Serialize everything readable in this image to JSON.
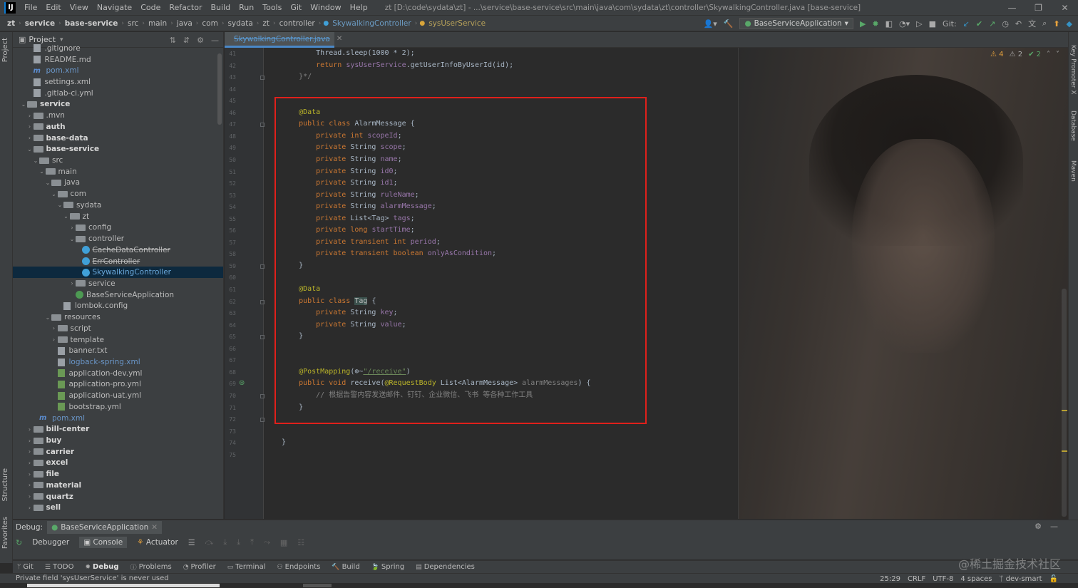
{
  "app": {
    "logo": "IJ",
    "menu": [
      "File",
      "Edit",
      "View",
      "Navigate",
      "Code",
      "Refactor",
      "Build",
      "Run",
      "Tools",
      "Git",
      "Window",
      "Help"
    ],
    "window_title": "zt [D:\\code\\sydata\\zt] - ...\\service\\base-service\\src\\main\\java\\com\\sydata\\zt\\controller\\SkywalkingController.java [base-service]",
    "window_controls": [
      "—",
      "❐",
      "✕"
    ]
  },
  "breadcrumbs": [
    {
      "label": "zt",
      "style": "bold"
    },
    {
      "label": "service",
      "style": "bold"
    },
    {
      "label": "base-service",
      "style": "bold"
    },
    {
      "label": "src",
      "style": ""
    },
    {
      "label": "main",
      "style": ""
    },
    {
      "label": "java",
      "style": ""
    },
    {
      "label": "com",
      "style": ""
    },
    {
      "label": "sydata",
      "style": ""
    },
    {
      "label": "zt",
      "style": ""
    },
    {
      "label": "controller",
      "style": ""
    },
    {
      "label": "SkywalkingController",
      "style": "class"
    },
    {
      "label": "sysUserService",
      "style": "method"
    }
  ],
  "toolbar": {
    "run_config": "BaseServiceApplication",
    "git_label": "Git:"
  },
  "side_tabs": {
    "left_top": "Project",
    "left_mid": "Structure",
    "left_bot": "Favorites",
    "right_1": "Key Promoter X",
    "right_2": "Database",
    "right_3": "Maven"
  },
  "project_panel": {
    "title": "Project",
    "tree": [
      {
        "indent": 1,
        "arrow": "",
        "icon": "file",
        "label": ".gitignore",
        "style": ""
      },
      {
        "indent": 1,
        "arrow": "",
        "icon": "file",
        "label": "README.md",
        "style": ""
      },
      {
        "indent": 1,
        "arrow": "",
        "icon": "maven",
        "label": "pom.xml",
        "style": "blue"
      },
      {
        "indent": 1,
        "arrow": "",
        "icon": "file",
        "label": "settings.xml",
        "style": ""
      },
      {
        "indent": 1,
        "arrow": "",
        "icon": "file",
        "label": ".gitlab-ci.yml",
        "style": ""
      },
      {
        "indent": 0,
        "arrow": "v",
        "icon": "folder",
        "label": "service",
        "style": "bold"
      },
      {
        "indent": 1,
        "arrow": ">",
        "icon": "folder",
        "label": ".mvn",
        "style": ""
      },
      {
        "indent": 1,
        "arrow": ">",
        "icon": "folder",
        "label": "auth",
        "style": "bold"
      },
      {
        "indent": 1,
        "arrow": ">",
        "icon": "folder",
        "label": "base-data",
        "style": "bold"
      },
      {
        "indent": 1,
        "arrow": "v",
        "icon": "folder",
        "label": "base-service",
        "style": "bold"
      },
      {
        "indent": 2,
        "arrow": "v",
        "icon": "folder",
        "label": "src",
        "style": ""
      },
      {
        "indent": 3,
        "arrow": "v",
        "icon": "folder",
        "label": "main",
        "style": ""
      },
      {
        "indent": 4,
        "arrow": "v",
        "icon": "folder",
        "label": "java",
        "style": ""
      },
      {
        "indent": 5,
        "arrow": "v",
        "icon": "folder",
        "label": "com",
        "style": ""
      },
      {
        "indent": 6,
        "arrow": "v",
        "icon": "folder",
        "label": "sydata",
        "style": ""
      },
      {
        "indent": 7,
        "arrow": "v",
        "icon": "folder",
        "label": "zt",
        "style": ""
      },
      {
        "indent": 8,
        "arrow": ">",
        "icon": "folder",
        "label": "config",
        "style": ""
      },
      {
        "indent": 8,
        "arrow": "v",
        "icon": "folder",
        "label": "controller",
        "style": ""
      },
      {
        "indent": 9,
        "arrow": "",
        "icon": "cls",
        "label": "CacheDataController",
        "style": "strike"
      },
      {
        "indent": 9,
        "arrow": "",
        "icon": "cls",
        "label": "ErrController",
        "style": "strike"
      },
      {
        "indent": 9,
        "arrow": "",
        "icon": "cls",
        "label": "SkywalkingController",
        "style": "sel"
      },
      {
        "indent": 8,
        "arrow": ">",
        "icon": "folder",
        "label": "service",
        "style": ""
      },
      {
        "indent": 8,
        "arrow": "",
        "icon": "spring",
        "label": "BaseServiceApplication",
        "style": ""
      },
      {
        "indent": 6,
        "arrow": "",
        "icon": "file",
        "label": "lombok.config",
        "style": ""
      },
      {
        "indent": 4,
        "arrow": "v",
        "icon": "folder",
        "label": "resources",
        "style": ""
      },
      {
        "indent": 5,
        "arrow": ">",
        "icon": "folder",
        "label": "script",
        "style": ""
      },
      {
        "indent": 5,
        "arrow": ">",
        "icon": "folder",
        "label": "template",
        "style": ""
      },
      {
        "indent": 5,
        "arrow": "",
        "icon": "file",
        "label": "banner.txt",
        "style": ""
      },
      {
        "indent": 5,
        "arrow": "",
        "icon": "file",
        "label": "logback-spring.xml",
        "style": "blue"
      },
      {
        "indent": 5,
        "arrow": "",
        "icon": "yml",
        "label": "application-dev.yml",
        "style": ""
      },
      {
        "indent": 5,
        "arrow": "",
        "icon": "yml",
        "label": "application-pro.yml",
        "style": ""
      },
      {
        "indent": 5,
        "arrow": "",
        "icon": "yml",
        "label": "application-uat.yml",
        "style": ""
      },
      {
        "indent": 5,
        "arrow": "",
        "icon": "yml",
        "label": "bootstrap.yml",
        "style": ""
      },
      {
        "indent": 2,
        "arrow": "",
        "icon": "maven",
        "label": "pom.xml",
        "style": "blue"
      },
      {
        "indent": 1,
        "arrow": ">",
        "icon": "folder",
        "label": "bill-center",
        "style": "bold"
      },
      {
        "indent": 1,
        "arrow": ">",
        "icon": "folder",
        "label": "buy",
        "style": "bold"
      },
      {
        "indent": 1,
        "arrow": ">",
        "icon": "folder",
        "label": "carrier",
        "style": "bold"
      },
      {
        "indent": 1,
        "arrow": ">",
        "icon": "folder",
        "label": "excel",
        "style": "bold"
      },
      {
        "indent": 1,
        "arrow": ">",
        "icon": "folder",
        "label": "file",
        "style": "bold"
      },
      {
        "indent": 1,
        "arrow": ">",
        "icon": "folder",
        "label": "material",
        "style": "bold"
      },
      {
        "indent": 1,
        "arrow": ">",
        "icon": "folder",
        "label": "quartz",
        "style": "bold"
      },
      {
        "indent": 1,
        "arrow": ">",
        "icon": "folder",
        "label": "sell",
        "style": "bold"
      }
    ]
  },
  "editor": {
    "tab_label": "SkywalkingController.java",
    "inspections": {
      "warnings": "4",
      "weak": "2",
      "ok": "2"
    },
    "first_line": 41,
    "lines": [
      [
        [
          "txt",
          "        Thread.sleep("
        ],
        [
          "txt",
          "1000 * 2"
        ],
        [
          "txt",
          ");"
        ]
      ],
      [
        [
          "kw",
          "        return "
        ],
        [
          "fld",
          "sysUserService"
        ],
        [
          "txt",
          ".getUserInfoByUserId(id);"
        ]
      ],
      [
        [
          "cmt",
          "    }*/"
        ]
      ],
      [],
      [],
      [
        [
          "ann",
          "    @Data"
        ]
      ],
      [
        [
          "kw",
          "    public class "
        ],
        [
          "txt",
          "AlarmMessage {"
        ]
      ],
      [
        [
          "kw",
          "        private int "
        ],
        [
          "fld",
          "scopeId"
        ],
        [
          "txt",
          ";"
        ]
      ],
      [
        [
          "kw",
          "        private "
        ],
        [
          "txt",
          "String "
        ],
        [
          "fld",
          "scope"
        ],
        [
          "txt",
          ";"
        ]
      ],
      [
        [
          "kw",
          "        private "
        ],
        [
          "txt",
          "String "
        ],
        [
          "fld",
          "name"
        ],
        [
          "txt",
          ";"
        ]
      ],
      [
        [
          "kw",
          "        private "
        ],
        [
          "txt",
          "String "
        ],
        [
          "fld",
          "id0"
        ],
        [
          "txt",
          ";"
        ]
      ],
      [
        [
          "kw",
          "        private "
        ],
        [
          "txt",
          "String "
        ],
        [
          "fld",
          "id1"
        ],
        [
          "txt",
          ";"
        ]
      ],
      [
        [
          "kw",
          "        private "
        ],
        [
          "txt",
          "String "
        ],
        [
          "fld",
          "ruleName"
        ],
        [
          "txt",
          ";"
        ]
      ],
      [
        [
          "kw",
          "        private "
        ],
        [
          "txt",
          "String "
        ],
        [
          "fld",
          "alarmMessage"
        ],
        [
          "txt",
          ";"
        ]
      ],
      [
        [
          "kw",
          "        private "
        ],
        [
          "txt",
          "List<Tag> "
        ],
        [
          "fld",
          "tags"
        ],
        [
          "txt",
          ";"
        ]
      ],
      [
        [
          "kw",
          "        private long "
        ],
        [
          "fld",
          "startTime"
        ],
        [
          "txt",
          ";"
        ]
      ],
      [
        [
          "kw",
          "        private transient int "
        ],
        [
          "fld",
          "period"
        ],
        [
          "txt",
          ";"
        ]
      ],
      [
        [
          "kw",
          "        private transient boolean "
        ],
        [
          "fld",
          "onlyAsCondition"
        ],
        [
          "txt",
          ";"
        ]
      ],
      [
        [
          "txt",
          "    }"
        ]
      ],
      [],
      [
        [
          "ann",
          "    @Data"
        ]
      ],
      [
        [
          "kw",
          "    public class "
        ],
        [
          "hl",
          "Tag"
        ],
        [
          "txt",
          " {"
        ]
      ],
      [
        [
          "kw",
          "        private "
        ],
        [
          "txt",
          "String "
        ],
        [
          "fld",
          "key"
        ],
        [
          "txt",
          ";"
        ]
      ],
      [
        [
          "kw",
          "        private "
        ],
        [
          "txt",
          "String "
        ],
        [
          "fld",
          "value"
        ],
        [
          "txt",
          ";"
        ]
      ],
      [
        [
          "txt",
          "    }"
        ]
      ],
      [],
      [],
      [
        [
          "ann",
          "    @PostMapping"
        ],
        [
          "txt",
          "(⊕~"
        ],
        [
          "url",
          "\"/receive\""
        ],
        [
          "txt",
          ")"
        ]
      ],
      [
        [
          "kw",
          "    public void "
        ],
        [
          "txt",
          "receive("
        ],
        [
          "ann",
          "@RequestBody "
        ],
        [
          "txt",
          "List<AlarmMessage> "
        ],
        [
          "cmt",
          "alarmMessages"
        ],
        [
          "txt",
          ") {"
        ]
      ],
      [
        [
          "cmt",
          "        // 根据告警内容发送邮件、钉钉、企业微信、飞书 等各种工作工具"
        ]
      ],
      [
        [
          "txt",
          "    }"
        ]
      ],
      [],
      [],
      [
        [
          "txt",
          "}"
        ]
      ],
      []
    ]
  },
  "debug": {
    "label": "Debug:",
    "session": "BaseServiceApplication",
    "tabs": [
      "Debugger",
      "Console",
      "Actuator"
    ]
  },
  "tool_windows": [
    "Git",
    "TODO",
    "Debug",
    "Problems",
    "Profiler",
    "Terminal",
    "Endpoints",
    "Build",
    "Spring",
    "Dependencies"
  ],
  "status": {
    "message": "Private field 'sysUserService' is never used",
    "position": "25:29",
    "line_sep": "CRLF",
    "encoding": "UTF-8",
    "indent": "4 spaces",
    "branch": "dev-smart"
  },
  "watermark": "@稀土掘金技术社区"
}
